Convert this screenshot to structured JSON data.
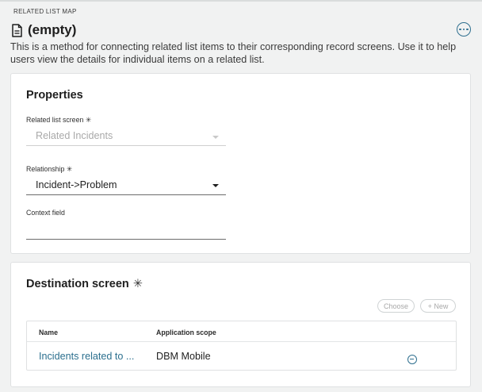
{
  "header": {
    "eyebrow": "RELATED LIST MAP",
    "title": "(empty)",
    "description": "This is a method for connecting related list items to their corresponding record screens. Use it to help users view the details for individual items on a related list."
  },
  "properties": {
    "title": "Properties",
    "related_list_screen": {
      "label": "Related list screen",
      "required_mark": "✳",
      "value": "Related Incidents",
      "state": "disabled"
    },
    "relationship": {
      "label": "Relationship",
      "required_mark": "✳",
      "value": "Incident->Problem"
    },
    "context_field": {
      "label": "Context field",
      "value": ""
    }
  },
  "destination": {
    "title": "Destination screen",
    "required_mark": "✳",
    "choose_label": "Choose",
    "new_label": "+ New",
    "columns": [
      "Name",
      "Application scope"
    ],
    "rows": [
      {
        "name": "Incidents related to ...",
        "scope": "DBM Mobile"
      }
    ]
  },
  "colors": {
    "accent": "#2f6f8f",
    "link": "#2b6f8e",
    "background": "#f1f2f2"
  },
  "icons": {
    "title": "document-icon",
    "more": "more-options-icon",
    "remove": "remove-circle-icon"
  }
}
